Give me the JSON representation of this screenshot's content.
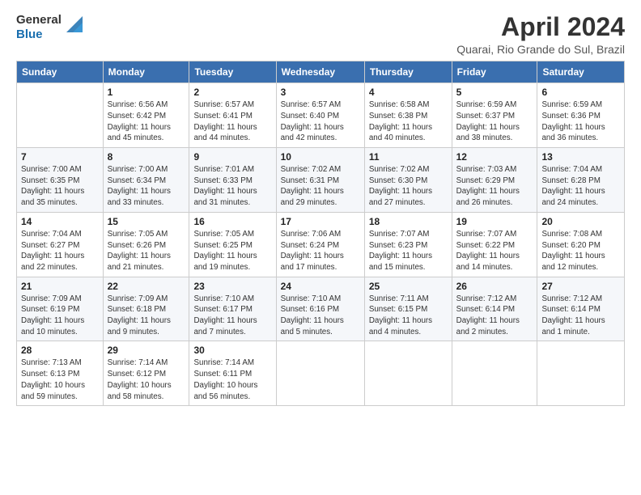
{
  "logo": {
    "text_general": "General",
    "text_blue": "Blue"
  },
  "header": {
    "month_title": "April 2024",
    "location": "Quarai, Rio Grande do Sul, Brazil"
  },
  "weekdays": [
    "Sunday",
    "Monday",
    "Tuesday",
    "Wednesday",
    "Thursday",
    "Friday",
    "Saturday"
  ],
  "weeks": [
    [
      {
        "day": "",
        "info": ""
      },
      {
        "day": "1",
        "info": "Sunrise: 6:56 AM\nSunset: 6:42 PM\nDaylight: 11 hours\nand 45 minutes."
      },
      {
        "day": "2",
        "info": "Sunrise: 6:57 AM\nSunset: 6:41 PM\nDaylight: 11 hours\nand 44 minutes."
      },
      {
        "day": "3",
        "info": "Sunrise: 6:57 AM\nSunset: 6:40 PM\nDaylight: 11 hours\nand 42 minutes."
      },
      {
        "day": "4",
        "info": "Sunrise: 6:58 AM\nSunset: 6:38 PM\nDaylight: 11 hours\nand 40 minutes."
      },
      {
        "day": "5",
        "info": "Sunrise: 6:59 AM\nSunset: 6:37 PM\nDaylight: 11 hours\nand 38 minutes."
      },
      {
        "day": "6",
        "info": "Sunrise: 6:59 AM\nSunset: 6:36 PM\nDaylight: 11 hours\nand 36 minutes."
      }
    ],
    [
      {
        "day": "7",
        "info": "Sunrise: 7:00 AM\nSunset: 6:35 PM\nDaylight: 11 hours\nand 35 minutes."
      },
      {
        "day": "8",
        "info": "Sunrise: 7:00 AM\nSunset: 6:34 PM\nDaylight: 11 hours\nand 33 minutes."
      },
      {
        "day": "9",
        "info": "Sunrise: 7:01 AM\nSunset: 6:33 PM\nDaylight: 11 hours\nand 31 minutes."
      },
      {
        "day": "10",
        "info": "Sunrise: 7:02 AM\nSunset: 6:31 PM\nDaylight: 11 hours\nand 29 minutes."
      },
      {
        "day": "11",
        "info": "Sunrise: 7:02 AM\nSunset: 6:30 PM\nDaylight: 11 hours\nand 27 minutes."
      },
      {
        "day": "12",
        "info": "Sunrise: 7:03 AM\nSunset: 6:29 PM\nDaylight: 11 hours\nand 26 minutes."
      },
      {
        "day": "13",
        "info": "Sunrise: 7:04 AM\nSunset: 6:28 PM\nDaylight: 11 hours\nand 24 minutes."
      }
    ],
    [
      {
        "day": "14",
        "info": "Sunrise: 7:04 AM\nSunset: 6:27 PM\nDaylight: 11 hours\nand 22 minutes."
      },
      {
        "day": "15",
        "info": "Sunrise: 7:05 AM\nSunset: 6:26 PM\nDaylight: 11 hours\nand 21 minutes."
      },
      {
        "day": "16",
        "info": "Sunrise: 7:05 AM\nSunset: 6:25 PM\nDaylight: 11 hours\nand 19 minutes."
      },
      {
        "day": "17",
        "info": "Sunrise: 7:06 AM\nSunset: 6:24 PM\nDaylight: 11 hours\nand 17 minutes."
      },
      {
        "day": "18",
        "info": "Sunrise: 7:07 AM\nSunset: 6:23 PM\nDaylight: 11 hours\nand 15 minutes."
      },
      {
        "day": "19",
        "info": "Sunrise: 7:07 AM\nSunset: 6:22 PM\nDaylight: 11 hours\nand 14 minutes."
      },
      {
        "day": "20",
        "info": "Sunrise: 7:08 AM\nSunset: 6:20 PM\nDaylight: 11 hours\nand 12 minutes."
      }
    ],
    [
      {
        "day": "21",
        "info": "Sunrise: 7:09 AM\nSunset: 6:19 PM\nDaylight: 11 hours\nand 10 minutes."
      },
      {
        "day": "22",
        "info": "Sunrise: 7:09 AM\nSunset: 6:18 PM\nDaylight: 11 hours\nand 9 minutes."
      },
      {
        "day": "23",
        "info": "Sunrise: 7:10 AM\nSunset: 6:17 PM\nDaylight: 11 hours\nand 7 minutes."
      },
      {
        "day": "24",
        "info": "Sunrise: 7:10 AM\nSunset: 6:16 PM\nDaylight: 11 hours\nand 5 minutes."
      },
      {
        "day": "25",
        "info": "Sunrise: 7:11 AM\nSunset: 6:15 PM\nDaylight: 11 hours\nand 4 minutes."
      },
      {
        "day": "26",
        "info": "Sunrise: 7:12 AM\nSunset: 6:14 PM\nDaylight: 11 hours\nand 2 minutes."
      },
      {
        "day": "27",
        "info": "Sunrise: 7:12 AM\nSunset: 6:14 PM\nDaylight: 11 hours\nand 1 minute."
      }
    ],
    [
      {
        "day": "28",
        "info": "Sunrise: 7:13 AM\nSunset: 6:13 PM\nDaylight: 10 hours\nand 59 minutes."
      },
      {
        "day": "29",
        "info": "Sunrise: 7:14 AM\nSunset: 6:12 PM\nDaylight: 10 hours\nand 58 minutes."
      },
      {
        "day": "30",
        "info": "Sunrise: 7:14 AM\nSunset: 6:11 PM\nDaylight: 10 hours\nand 56 minutes."
      },
      {
        "day": "",
        "info": ""
      },
      {
        "day": "",
        "info": ""
      },
      {
        "day": "",
        "info": ""
      },
      {
        "day": "",
        "info": ""
      }
    ]
  ]
}
